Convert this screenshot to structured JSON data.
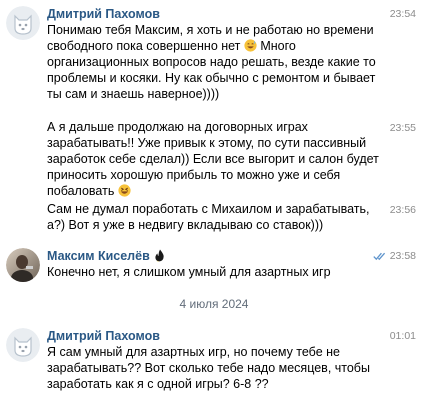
{
  "messages": [
    {
      "author": "Дмитрий Пахомов",
      "time": "23:54",
      "text_a": "Понимаю тебя Максим, я хоть и не работаю но времени свободного пока совершенно нет ",
      "text_b": " Много организационных вопросов надо решать, везде какие то проблемы и косяки. Ну как обычно с ремонтом и бывает ты сам и знаешь наверное))))"
    },
    {
      "time": "23:55",
      "text_a": "А я дальше продолжаю на договорных играх зарабатывать!! Уже привык к этому, по сути пассивный заработок себе сделал)) Если все выгорит и салон будет приносить хорошую прибыль то можно уже и себя побаловать ",
      "text_b": ""
    },
    {
      "time": "23:56",
      "text": "Сам не думал поработать с Михаилом и зарабатывать, а?) Вот я уже в недвигу вкладываю со ставок)))"
    },
    {
      "author": "Максим Киселёв",
      "time": "23:58",
      "text": "Конечно нет, я слишком умный для азартных игр"
    },
    {
      "author": "Дмитрий Пахомов",
      "time": "01:01",
      "text": "Я сам умный для азартных игр, но почему тебе не зарабатывать?? Вот сколько тебе надо месяцев, чтобы заработать как я с одной игры? 6-8 ??"
    }
  ],
  "date_separator": "4 июля 2024",
  "colors": {
    "author_name": "#2a5885",
    "time": "#8c8c8c",
    "read_check": "#5e94cc",
    "date_separator": "#626d7a"
  },
  "icons": {
    "avatar_default": "dog-avatar-icon",
    "emoji_1": "grinning-sweat-emoji-icon",
    "emoji_2": "grinning-squint-emoji-icon",
    "badge": "black-flame-icon",
    "read": "double-check-icon"
  }
}
